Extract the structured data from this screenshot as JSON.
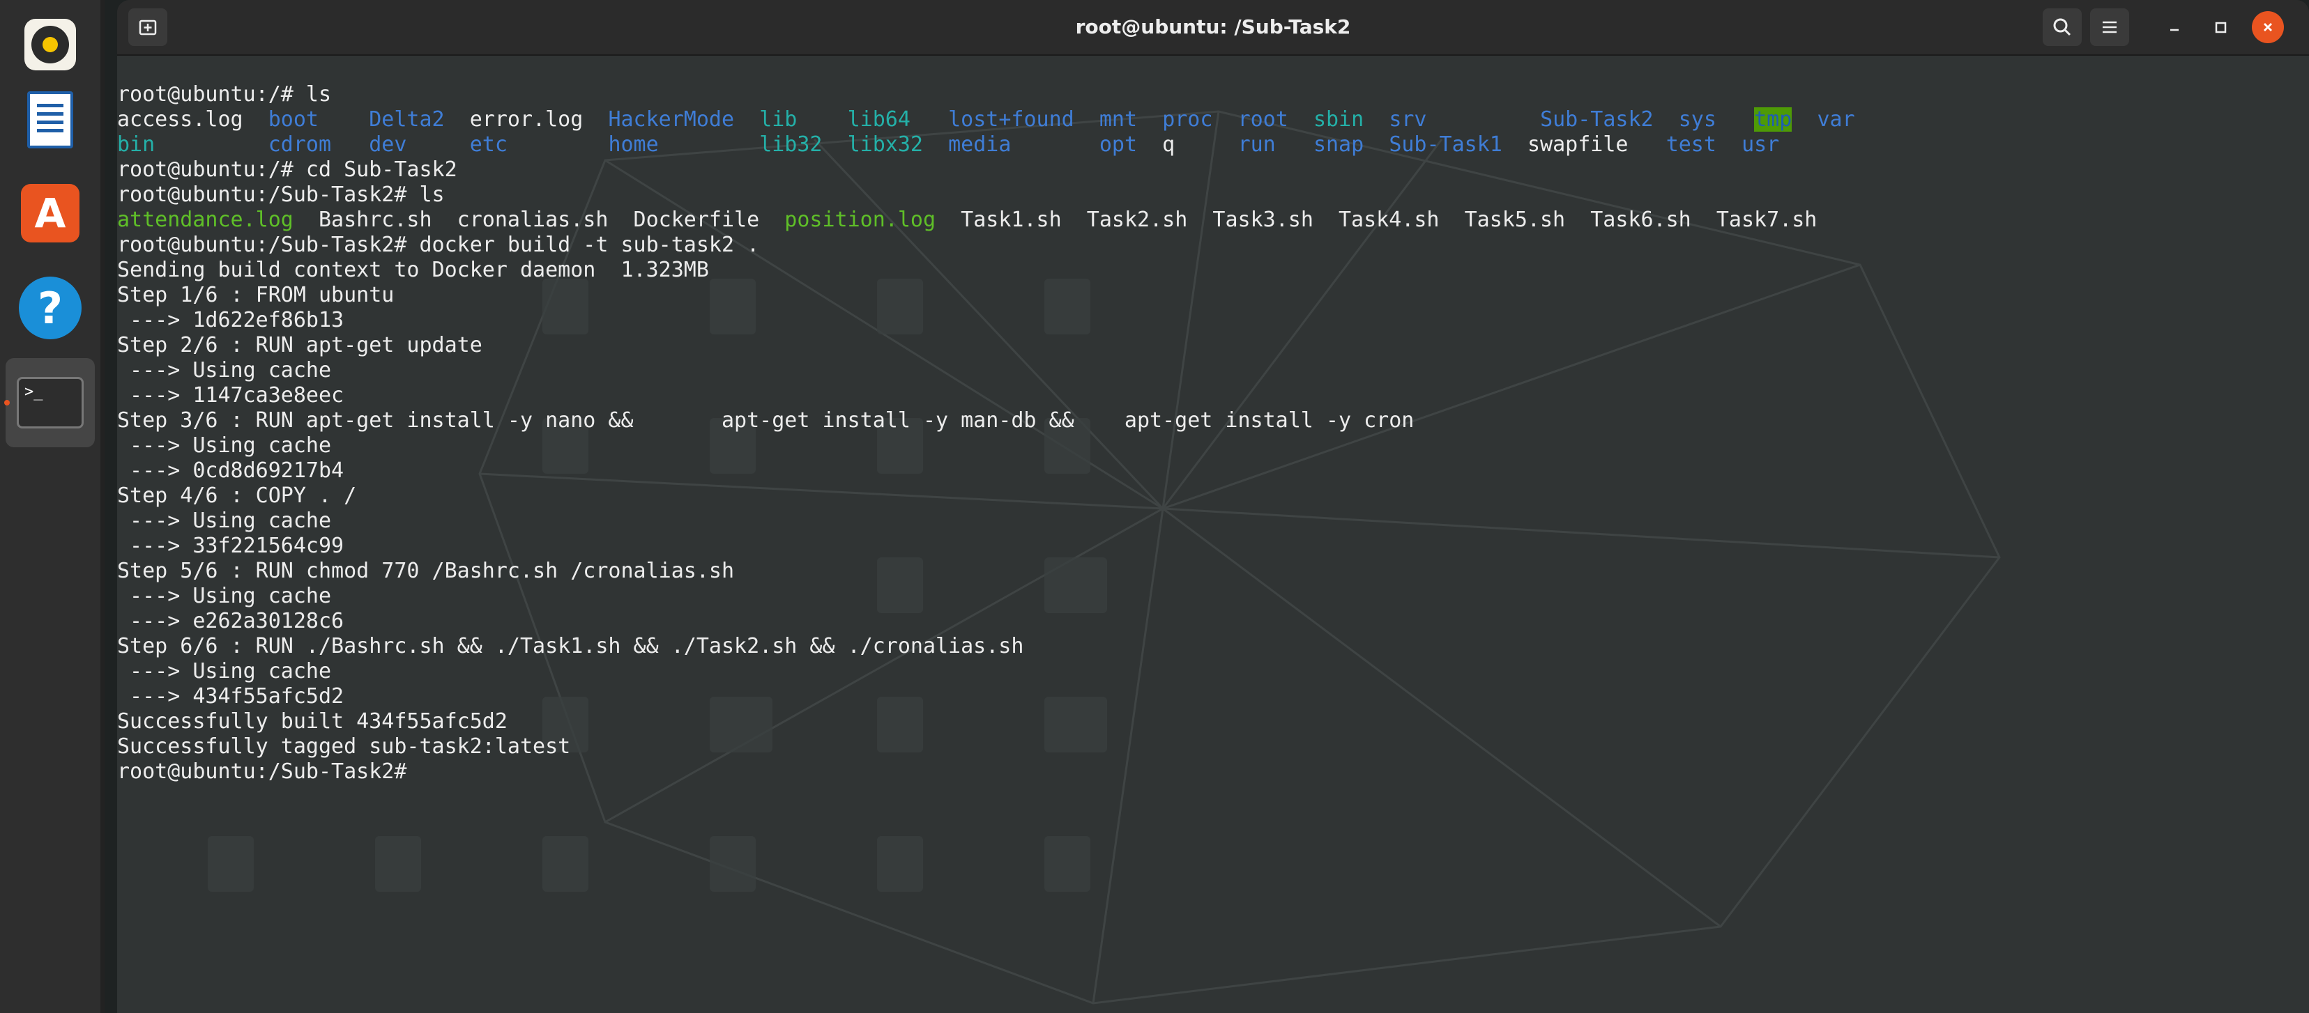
{
  "window": {
    "title": "root@ubuntu: /Sub-Task2"
  },
  "dock": {
    "items": [
      {
        "name": "rhythmbox",
        "icon": "music-disc-icon"
      },
      {
        "name": "libreoffice-writer",
        "icon": "document-icon"
      },
      {
        "name": "ubuntu-software",
        "icon": "store-bag-icon",
        "glyph": "A"
      },
      {
        "name": "help",
        "icon": "help-icon",
        "glyph": "?"
      },
      {
        "name": "terminal",
        "icon": "terminal-icon",
        "glyph": ">_"
      }
    ]
  },
  "colors": {
    "prompt": "#ececec",
    "directory": "#3f7dd6",
    "executable": "#5fbf28",
    "symlink": "#24b0a8",
    "sticky_bg": "#4e9a06",
    "close_button": "#e95420"
  },
  "terminal": {
    "lines": [
      [
        {
          "t": "root@ubuntu:/# ls"
        }
      ],
      [
        {
          "t": "access.log  "
        },
        {
          "t": "boot",
          "c": "dir"
        },
        {
          "t": "    "
        },
        {
          "t": "Delta2",
          "c": "dir"
        },
        {
          "t": "  error.log  "
        },
        {
          "t": "HackerMode",
          "c": "dir"
        },
        {
          "t": "  "
        },
        {
          "t": "lib",
          "c": "sym"
        },
        {
          "t": "    "
        },
        {
          "t": "lib64",
          "c": "sym"
        },
        {
          "t": "   "
        },
        {
          "t": "lost+found",
          "c": "dir"
        },
        {
          "t": "  "
        },
        {
          "t": "mnt",
          "c": "dir"
        },
        {
          "t": "  "
        },
        {
          "t": "proc",
          "c": "dir"
        },
        {
          "t": "  "
        },
        {
          "t": "root",
          "c": "dir"
        },
        {
          "t": "  "
        },
        {
          "t": "sbin",
          "c": "sym"
        },
        {
          "t": "  "
        },
        {
          "t": "srv",
          "c": "dir"
        },
        {
          "t": "         "
        },
        {
          "t": "Sub-Task2",
          "c": "dir"
        },
        {
          "t": "  "
        },
        {
          "t": "sys",
          "c": "dir"
        },
        {
          "t": "   "
        },
        {
          "t": "tmp",
          "c": "hl"
        },
        {
          "t": "  "
        },
        {
          "t": "var",
          "c": "dir"
        }
      ],
      [
        {
          "t": "bin",
          "c": "sym"
        },
        {
          "t": "         "
        },
        {
          "t": "cdrom",
          "c": "dir"
        },
        {
          "t": "   "
        },
        {
          "t": "dev",
          "c": "dir"
        },
        {
          "t": "     "
        },
        {
          "t": "etc",
          "c": "dir"
        },
        {
          "t": "        "
        },
        {
          "t": "home",
          "c": "dir"
        },
        {
          "t": "        "
        },
        {
          "t": "lib32",
          "c": "sym"
        },
        {
          "t": "  "
        },
        {
          "t": "libx32",
          "c": "sym"
        },
        {
          "t": "  "
        },
        {
          "t": "media",
          "c": "dir"
        },
        {
          "t": "       "
        },
        {
          "t": "opt",
          "c": "dir"
        },
        {
          "t": "  q     "
        },
        {
          "t": "run",
          "c": "dir"
        },
        {
          "t": "   "
        },
        {
          "t": "snap",
          "c": "dir"
        },
        {
          "t": "  "
        },
        {
          "t": "Sub-Task1",
          "c": "dir"
        },
        {
          "t": "  swapfile   "
        },
        {
          "t": "test",
          "c": "dir"
        },
        {
          "t": "  "
        },
        {
          "t": "usr",
          "c": "dir"
        }
      ],
      [
        {
          "t": "root@ubuntu:/# cd Sub-Task2"
        }
      ],
      [
        {
          "t": "root@ubuntu:/Sub-Task2# ls"
        }
      ],
      [
        {
          "t": "attendance.log",
          "c": "exe"
        },
        {
          "t": "  Bashrc.sh  cronalias.sh  Dockerfile  "
        },
        {
          "t": "position.log",
          "c": "exe"
        },
        {
          "t": "  Task1.sh  Task2.sh  Task3.sh  Task4.sh  Task5.sh  Task6.sh  Task7.sh"
        }
      ],
      [
        {
          "t": "root@ubuntu:/Sub-Task2# docker build -t sub-task2 ."
        }
      ],
      [
        {
          "t": "Sending build context to Docker daemon  1.323MB"
        }
      ],
      [
        {
          "t": "Step 1/6 : FROM ubuntu"
        }
      ],
      [
        {
          "t": " ---> 1d622ef86b13"
        }
      ],
      [
        {
          "t": "Step 2/6 : RUN apt-get update"
        }
      ],
      [
        {
          "t": " ---> Using cache"
        }
      ],
      [
        {
          "t": " ---> 1147ca3e8eec"
        }
      ],
      [
        {
          "t": "Step 3/6 : RUN apt-get install -y nano &&       apt-get install -y man-db &&    apt-get install -y cron"
        }
      ],
      [
        {
          "t": " ---> Using cache"
        }
      ],
      [
        {
          "t": " ---> 0cd8d69217b4"
        }
      ],
      [
        {
          "t": "Step 4/6 : COPY . /"
        }
      ],
      [
        {
          "t": " ---> Using cache"
        }
      ],
      [
        {
          "t": " ---> 33f221564c99"
        }
      ],
      [
        {
          "t": "Step 5/6 : RUN chmod 770 /Bashrc.sh /cronalias.sh"
        }
      ],
      [
        {
          "t": " ---> Using cache"
        }
      ],
      [
        {
          "t": " ---> e262a30128c6"
        }
      ],
      [
        {
          "t": "Step 6/6 : RUN ./Bashrc.sh && ./Task1.sh && ./Task2.sh && ./cronalias.sh"
        }
      ],
      [
        {
          "t": " ---> Using cache"
        }
      ],
      [
        {
          "t": " ---> 434f55afc5d2"
        }
      ],
      [
        {
          "t": "Successfully built 434f55afc5d2"
        }
      ],
      [
        {
          "t": "Successfully tagged sub-task2:latest"
        }
      ],
      [
        {
          "t": "root@ubuntu:/Sub-Task2# "
        }
      ]
    ]
  }
}
